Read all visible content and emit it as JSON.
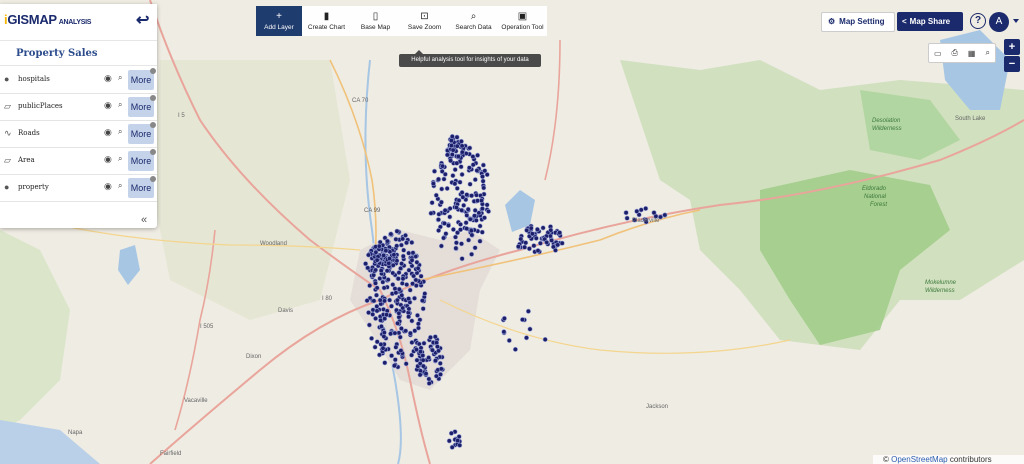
{
  "panel": {
    "logo_main": "GISMAP",
    "logo_sub": "ANALYSIS",
    "back_icon": "arrow-left-icon",
    "title": "Property Sales",
    "more_label": "More",
    "collapse_glyph": "«",
    "layers": [
      {
        "name": "hospitals",
        "icon": "map-pin-icon",
        "glyph": "●"
      },
      {
        "name": "publicPlaces",
        "icon": "polygon-icon",
        "glyph": "▱"
      },
      {
        "name": "Roads",
        "icon": "line-icon",
        "glyph": "∿"
      },
      {
        "name": "Area",
        "icon": "polygon-icon",
        "glyph": "▱"
      },
      {
        "name": "property",
        "icon": "map-pin-icon",
        "glyph": "●"
      }
    ]
  },
  "toolbar": {
    "tools": [
      {
        "label": "Add Layer",
        "glyph": "+",
        "icon": "plus-icon",
        "active": true
      },
      {
        "label": "Create Chart",
        "glyph": "▮",
        "icon": "bar-chart-icon"
      },
      {
        "label": "Base Map",
        "glyph": "▯",
        "icon": "map-icon"
      },
      {
        "label": "Save Zoom",
        "glyph": "⊡",
        "icon": "save-zoom-icon"
      },
      {
        "label": "Search Data",
        "glyph": "⌕",
        "icon": "search-icon"
      },
      {
        "label": "Operation Tool",
        "glyph": "▣",
        "icon": "operation-tool-icon"
      }
    ],
    "tooltip": "Helpful analysis tool for insights of your data"
  },
  "topright": {
    "map_setting": "Map Setting",
    "map_share": "Map Share",
    "help": "?",
    "avatar": "A"
  },
  "mapcontrols": {
    "zoom_in": "+",
    "zoom_out": "−",
    "minitool_glyphs": [
      "▭",
      "⎙",
      "▦",
      "⌕"
    ]
  },
  "map_labels": {
    "eldorado": [
      "Eldorado",
      "National",
      "Forest"
    ],
    "desolation": [
      "Desolation",
      "Wilderness"
    ],
    "mokelumne": [
      "Mokelumne",
      "Wilderness"
    ],
    "south_lake": "South Lake",
    "vacaville": "Vacaville",
    "napa": "Napa",
    "fairfield": "Fairfield",
    "woodland": "Woodland",
    "davis": "Davis",
    "dixon": "Dixon",
    "jackson": "Jackson",
    "placerville": "Placerville",
    "i5": "I 5",
    "i80": "I 80",
    "i505": "I 505",
    "ca99": "CA 99",
    "ca70": "CA 70"
  },
  "attribution": {
    "prefix": "© ",
    "link": "OpenStreetMap",
    "suffix": " contributors"
  }
}
